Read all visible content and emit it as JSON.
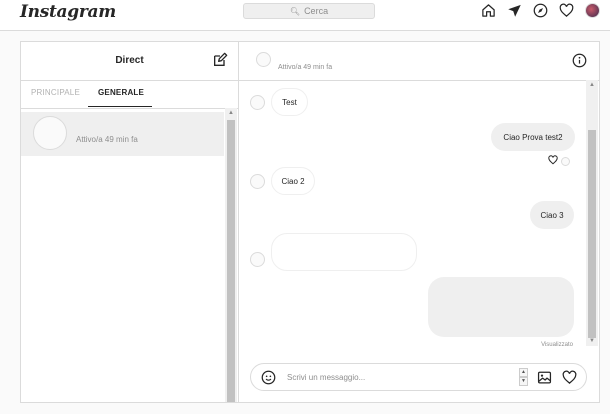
{
  "header": {
    "logo": "Instagram",
    "search_placeholder": "Cerca",
    "icons": [
      "home-icon",
      "direct-icon",
      "explore-icon",
      "activity-heart-icon",
      "profile-avatar"
    ]
  },
  "inbox": {
    "title": "Direct",
    "tabs": [
      {
        "label": "PRINCIPALE",
        "active": false
      },
      {
        "label": "GENERALE",
        "active": true
      }
    ],
    "threads": [
      {
        "name": "",
        "status": "Attivo/a 49 min fa",
        "selected": true
      }
    ]
  },
  "chat": {
    "header_name": "",
    "header_status": "Attivo/a 49 min fa",
    "messages": [
      {
        "direction": "in",
        "text": "Test"
      },
      {
        "direction": "out",
        "text": "Ciao Prova test2",
        "reaction": "heart"
      },
      {
        "direction": "in",
        "text": "Ciao 2"
      },
      {
        "direction": "out",
        "text": "Ciao 3"
      },
      {
        "direction": "in",
        "text": ""
      },
      {
        "direction": "out",
        "text": ""
      }
    ],
    "seen_label": "Visualizzato",
    "composer_placeholder": "Scrivi un messaggio..."
  },
  "colors": {
    "border": "#dbdbdb",
    "bubble_out": "#efefef",
    "text": "#262626",
    "muted": "#8e8e8e"
  }
}
